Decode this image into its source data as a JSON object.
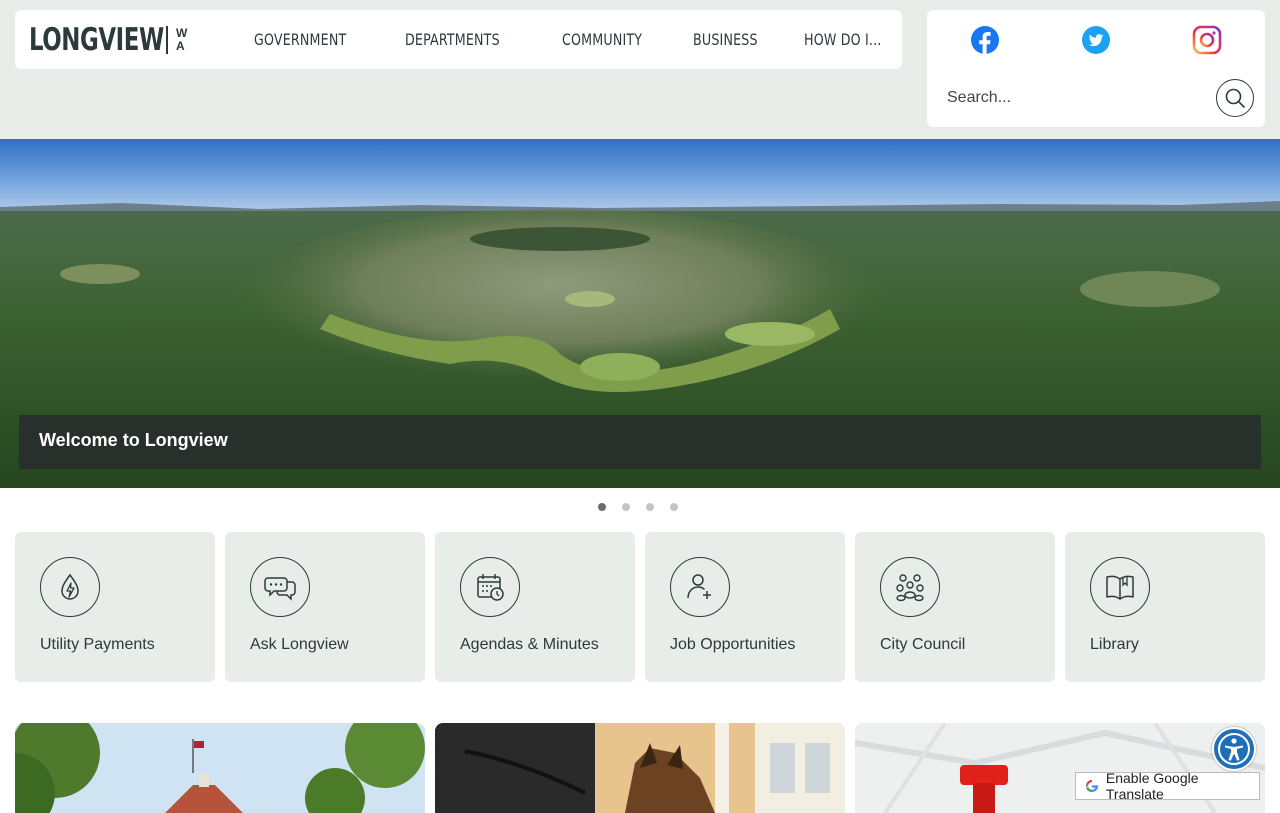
{
  "logo": {
    "word": "LONGVIEW",
    "state_top": "W",
    "state_bottom": "A"
  },
  "nav": {
    "items": [
      {
        "label": "GOVERNMENT"
      },
      {
        "label": "DEPARTMENTS"
      },
      {
        "label": "COMMUNITY"
      },
      {
        "label": "BUSINESS"
      },
      {
        "label": "HOW DO I..."
      }
    ]
  },
  "social": {
    "icons": [
      "facebook-icon",
      "twitter-icon",
      "instagram-icon"
    ],
    "colors": {
      "facebook": "#1877f2",
      "twitter": "#1da1f2"
    }
  },
  "search": {
    "placeholder": "Search...",
    "icon": "search-icon"
  },
  "hero": {
    "caption": "Welcome to Longview",
    "slide_count": 4,
    "active_slide": 1
  },
  "tiles": [
    {
      "label": "Utility Payments",
      "icon": "utility-drop-bolt-icon"
    },
    {
      "label": "Ask Longview",
      "icon": "chat-bubbles-icon"
    },
    {
      "label": "Agendas & Minutes",
      "icon": "calendar-clock-icon"
    },
    {
      "label": "Job Opportunities",
      "icon": "person-plus-icon"
    },
    {
      "label": "City Council",
      "icon": "group-people-icon"
    },
    {
      "label": "Library",
      "icon": "open-book-icon"
    }
  ],
  "widgets": {
    "accessibility_icon": "accessibility-icon",
    "translate_label": "Enable Google Translate"
  },
  "colors": {
    "band": "#e8ede9",
    "text": "#2c3a3d",
    "accessibility": "#1f6eb8"
  }
}
